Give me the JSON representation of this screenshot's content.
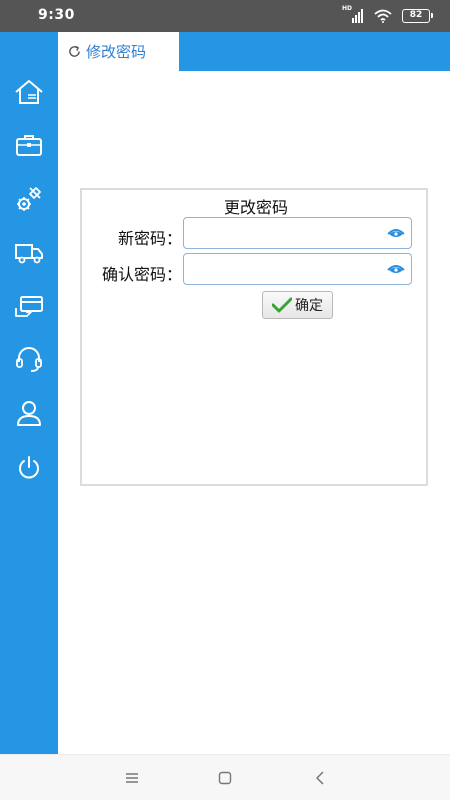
{
  "status_bar": {
    "time": "9:30",
    "network_label": "HD",
    "battery": "82",
    "icons": [
      "signal-icon",
      "wifi-icon",
      "battery-icon"
    ]
  },
  "sidebar": {
    "items": [
      {
        "name": "home",
        "icon": "home-icon"
      },
      {
        "name": "briefcase",
        "icon": "briefcase-icon"
      },
      {
        "name": "tools",
        "icon": "wrench-gear-icon"
      },
      {
        "name": "truck",
        "icon": "truck-icon"
      },
      {
        "name": "card",
        "icon": "card-icon"
      },
      {
        "name": "support",
        "icon": "headset-icon"
      },
      {
        "name": "user",
        "icon": "user-icon"
      },
      {
        "name": "power",
        "icon": "power-icon"
      }
    ]
  },
  "tab": {
    "label": "修改密码",
    "icon": "refresh-icon"
  },
  "form": {
    "title": "更改密码",
    "new_password_label": "新密码：",
    "new_password_value": "",
    "confirm_password_label": "确认密码：",
    "confirm_password_value": "",
    "submit_label": "确定"
  },
  "colors": {
    "accent": "#2596e4",
    "tab_text": "#2f7fd0",
    "check": "#3aa335",
    "status_bar": "#555555"
  },
  "nav_bar": {
    "buttons": [
      "menu-icon",
      "home-square-icon",
      "back-icon"
    ]
  }
}
